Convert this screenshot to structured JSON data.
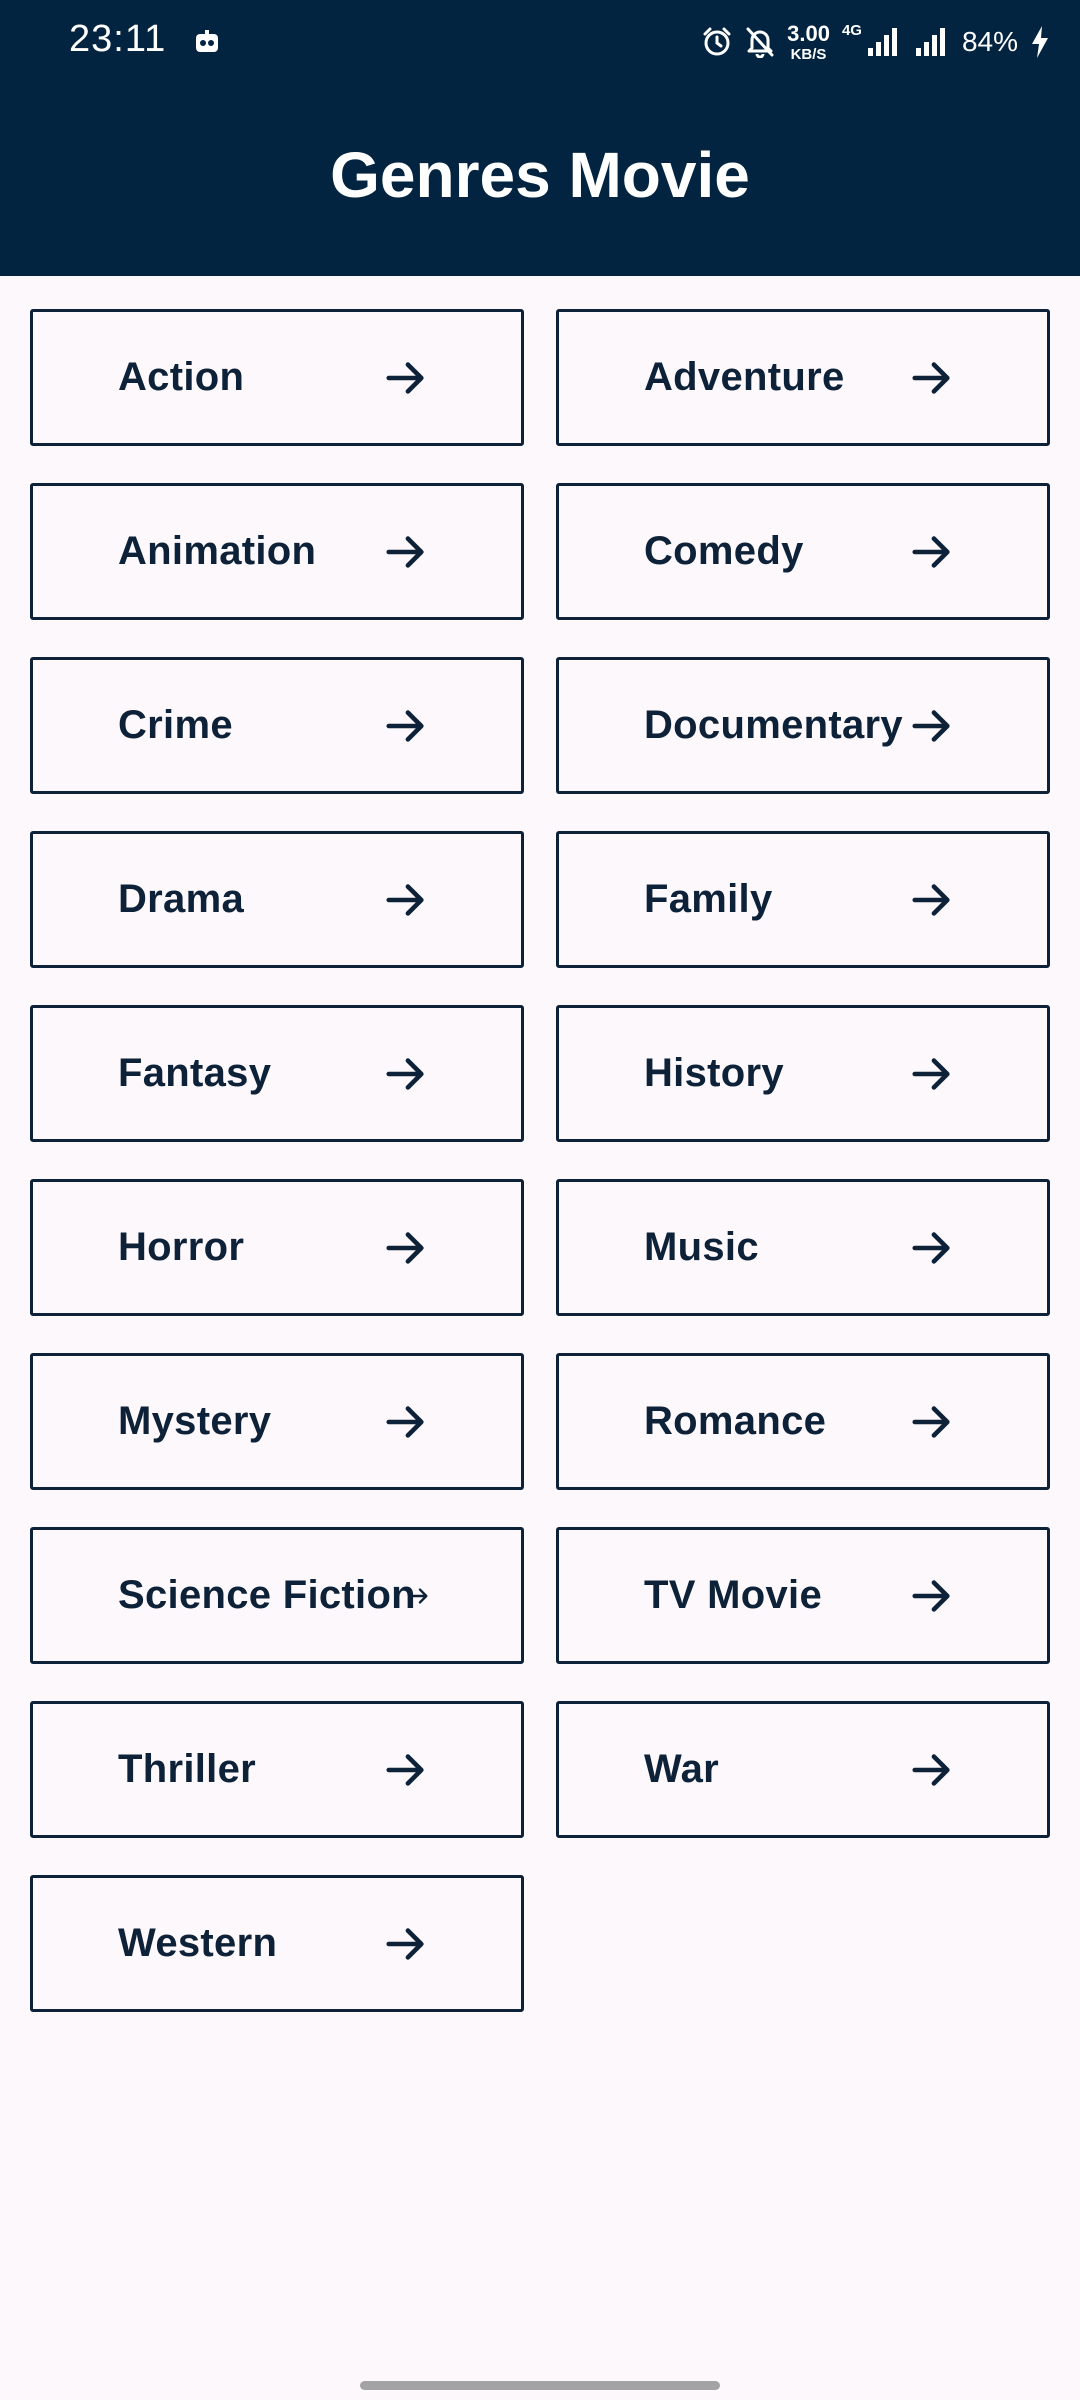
{
  "status_bar": {
    "time": "23:11",
    "net_speed_value": "3.00",
    "net_speed_unit": "KB/S",
    "net_type": "4G",
    "battery": "84%",
    "icons": [
      "alarm-icon",
      "bell-off-icon",
      "signal-icon",
      "signal-icon",
      "charging-icon"
    ]
  },
  "app_bar": {
    "title": "Genres Movie"
  },
  "genres": [
    "Action",
    "Adventure",
    "Animation",
    "Comedy",
    "Crime",
    "Documentary",
    "Drama",
    "Family",
    "Fantasy",
    "History",
    "Horror",
    "Music",
    "Mystery",
    "Romance",
    "Science Fiction",
    "TV Movie",
    "Thriller",
    "War",
    "Western"
  ],
  "colors": {
    "app_bar_bg": "#032440",
    "page_bg": "#fdf8fb",
    "card_border": "#0d2238",
    "text": "#0d2238"
  }
}
